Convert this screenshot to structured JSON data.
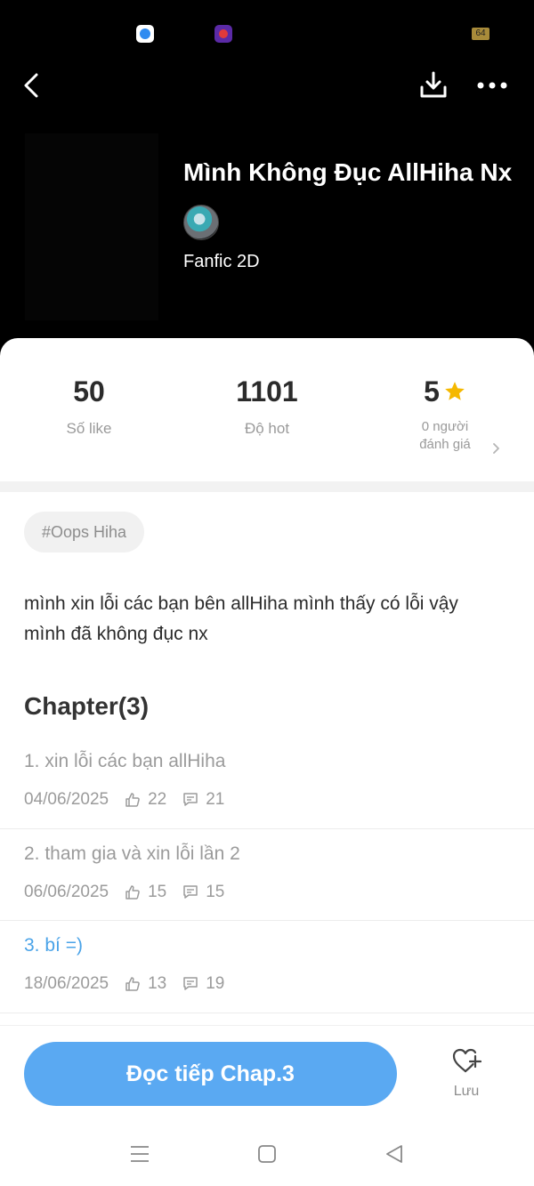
{
  "status_bar": {
    "battery": "64"
  },
  "story": {
    "title": "Mình Không Đục AllHiha Nx",
    "category": "Fanfic 2D"
  },
  "stats": {
    "likes": {
      "value": "50",
      "label": "Số like"
    },
    "hot": {
      "value": "1101",
      "label": "Độ hot"
    },
    "rating": {
      "value": "5",
      "label_line1": "0 người",
      "label_line2": "đánh giá"
    }
  },
  "tag": "#Oops Hiha",
  "description": "mình xin lỗi các bạn bên allHiha mình thấy có lỗi vậy mình đã không đục nx",
  "chapters_heading": "Chapter(3)",
  "chapters": [
    {
      "title": "1. xin lỗi các bạn allHiha",
      "date": "04/06/2025",
      "likes": "22",
      "comments": "21"
    },
    {
      "title": "2. tham gia và xin lỗi lần 2",
      "date": "06/06/2025",
      "likes": "15",
      "comments": "15"
    },
    {
      "title": "3. bí =)",
      "date": "18/06/2025",
      "likes": "13",
      "comments": "19"
    }
  ],
  "bottom_bar": {
    "continue_label": "Đọc tiếp Chap.3",
    "save_label": "Lưu"
  },
  "colors": {
    "accent": "#5aa9f2",
    "current_chapter": "#4aa3e8",
    "star": "#f5b800"
  },
  "icons": [
    "back-arrow-icon",
    "download-icon",
    "more-icon",
    "star-icon",
    "chevron-right-icon",
    "thumbs-up-icon",
    "comment-icon",
    "heart-plus-icon",
    "menu-icon",
    "home-icon",
    "back-triangle-icon"
  ]
}
